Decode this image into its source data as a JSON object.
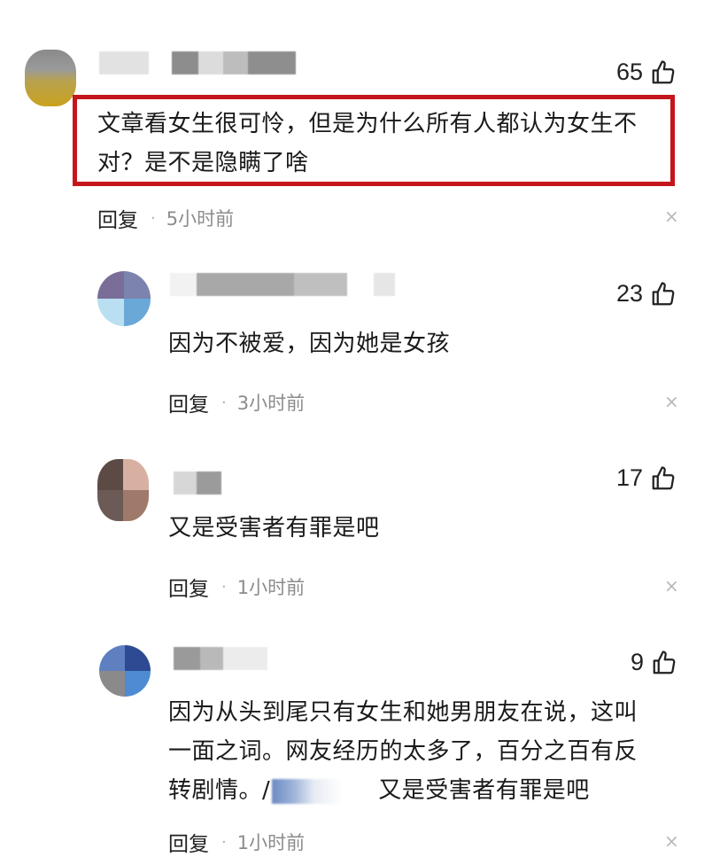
{
  "comments": [
    {
      "likes": "65",
      "text_lines": [
        "文章看女生很可怜，但是为什么所有人都认为女生不",
        "对？是不是隐瞒了啥"
      ],
      "reply_label": "回复",
      "time": "5小时前",
      "close": "×"
    },
    {
      "likes": "23",
      "text_lines": [
        "因为不被爱，因为她是女孩"
      ],
      "reply_label": "回复",
      "time": "3小时前",
      "close": "×"
    },
    {
      "likes": "17",
      "text_lines": [
        "又是受害者有罪是吧"
      ],
      "reply_label": "回复",
      "time": "1小时前",
      "close": "×"
    },
    {
      "likes": "9",
      "text_lines": [
        "因为从头到尾只有女生和她男朋友在说，这叫",
        "一面之词。网友经历的太多了，百分之百有反"
      ],
      "text_line3_prefix": "转剧情。/",
      "text_line3_suffix": "又是受害者有罪是吧",
      "reply_label": "回复",
      "time": "1小时前",
      "close": "×"
    }
  ],
  "colors": {
    "highlight": "#c4161c",
    "time": "#8c8c8c"
  },
  "icons": [
    "like-thumb-icon",
    "close-icon"
  ]
}
